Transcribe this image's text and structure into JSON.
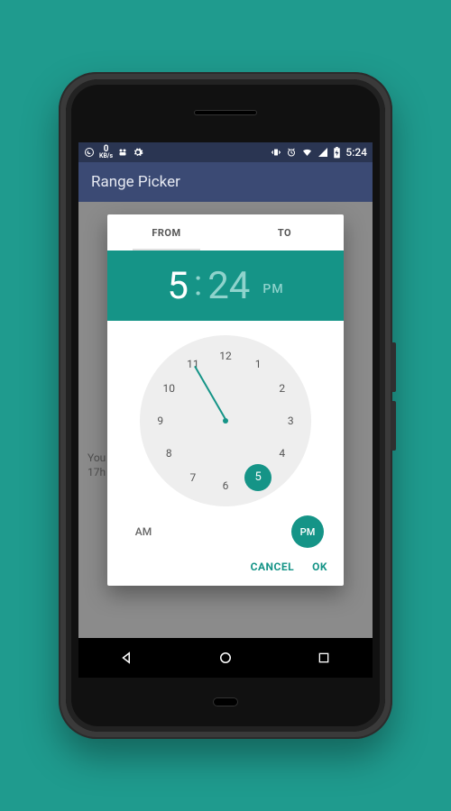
{
  "statusbar": {
    "speed_num": "0",
    "speed_unit": "KB/s",
    "time": "5:24"
  },
  "appbar": {
    "title": "Range Picker"
  },
  "background": {
    "line1": "You",
    "line2": "17h"
  },
  "dialog": {
    "tabs": {
      "from": "FROM",
      "to": "TO"
    },
    "time": {
      "hour": "5",
      "minute": "24",
      "ampm": "PM"
    },
    "clock": {
      "h1": "1",
      "h2": "2",
      "h3": "3",
      "h4": "4",
      "h5": "5",
      "h6": "6",
      "h7": "7",
      "h8": "8",
      "h9": "9",
      "h10": "10",
      "h11": "11",
      "h12": "12",
      "selected": "5"
    },
    "am": "AM",
    "pm": "PM",
    "cancel": "CANCEL",
    "ok": "OK"
  }
}
